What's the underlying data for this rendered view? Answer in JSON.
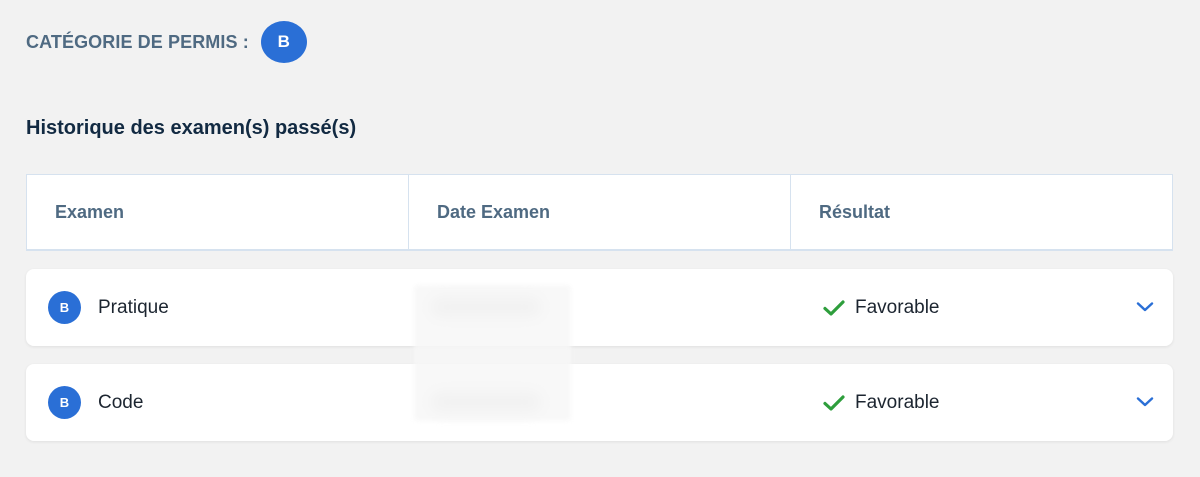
{
  "category": {
    "label": "CATÉGORIE DE PERMIS :",
    "badge": "B"
  },
  "section_title": "Historique des examen(s) passé(s)",
  "table": {
    "headers": [
      "Examen",
      "Date Examen",
      "Résultat"
    ],
    "rows": [
      {
        "badge": "B",
        "exam": "Pratique",
        "date": "",
        "result": "Favorable",
        "result_icon": "check-icon",
        "expand_icon": "chevron-down-icon"
      },
      {
        "badge": "B",
        "exam": "Code",
        "date": "",
        "result": "Favorable",
        "result_icon": "check-icon",
        "expand_icon": "chevron-down-icon"
      }
    ]
  },
  "colors": {
    "accent": "#2a6fd6",
    "success": "#2e9e3c",
    "header_text": "#4f6a82",
    "title_text": "#122a42",
    "background": "#f2f2f2"
  }
}
